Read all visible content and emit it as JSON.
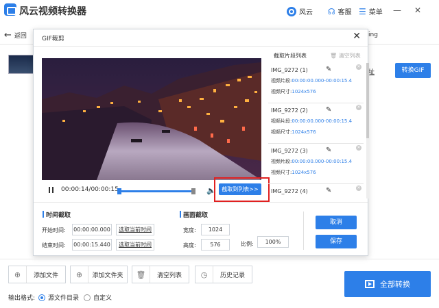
{
  "app": {
    "title": "风云视频转换器",
    "brand_label": "风云",
    "service_label": "客服",
    "menu_label": "菜单",
    "accent_color": "#2d7fe8"
  },
  "toolbar": {
    "back_label": "返回",
    "convert_gif_label": "转换GIF",
    "peek_link_text": "址",
    "peek_top_text": "ing"
  },
  "dialog": {
    "title": "GIF裁剪",
    "player": {
      "time_display": "00:00:14/00:00:15",
      "capture_button_label": "截取到列表>>"
    },
    "clip_list": {
      "title": "截取片段列表",
      "clear_label": "清空列表",
      "segment_label": "视频片段:",
      "size_label": "视频尺寸:",
      "items": [
        {
          "name": "IMG_9272 (1)",
          "segment": "00:00:00.000-00:00:15.4",
          "size": "1024x576"
        },
        {
          "name": "IMG_9272 (2)",
          "segment": "00:00:00.000-00:00:15.4",
          "size": "1024x576"
        },
        {
          "name": "IMG_9272 (3)",
          "segment": "00:00:00.000-00:00:15.4",
          "size": "1024x576"
        },
        {
          "name": "IMG_9272 (4)",
          "segment": "",
          "size": ""
        }
      ]
    },
    "time_section": {
      "title": "时间截取",
      "start_label": "开始时间:",
      "start_value": "00:00:00.000",
      "end_label": "结束时间:",
      "end_value": "00:00:15.440",
      "pick_current_label": "选取当前时间"
    },
    "frame_section": {
      "title": "画面截取",
      "width_label": "宽度:",
      "width_value": "1024",
      "height_label": "高度:",
      "height_value": "576",
      "ratio_label": "比例:",
      "ratio_value": "100%"
    },
    "cancel_label": "取消",
    "save_label": "保存"
  },
  "bottom": {
    "add_file_label": "添加文件",
    "add_folder_label": "添加文件夹",
    "clear_list_label": "清空列表",
    "history_label": "历史记录",
    "convert_all_label": "全部转换",
    "output_format_label": "输出格式:",
    "option_source_dir": "源文件目录",
    "option_custom": "自定义"
  }
}
